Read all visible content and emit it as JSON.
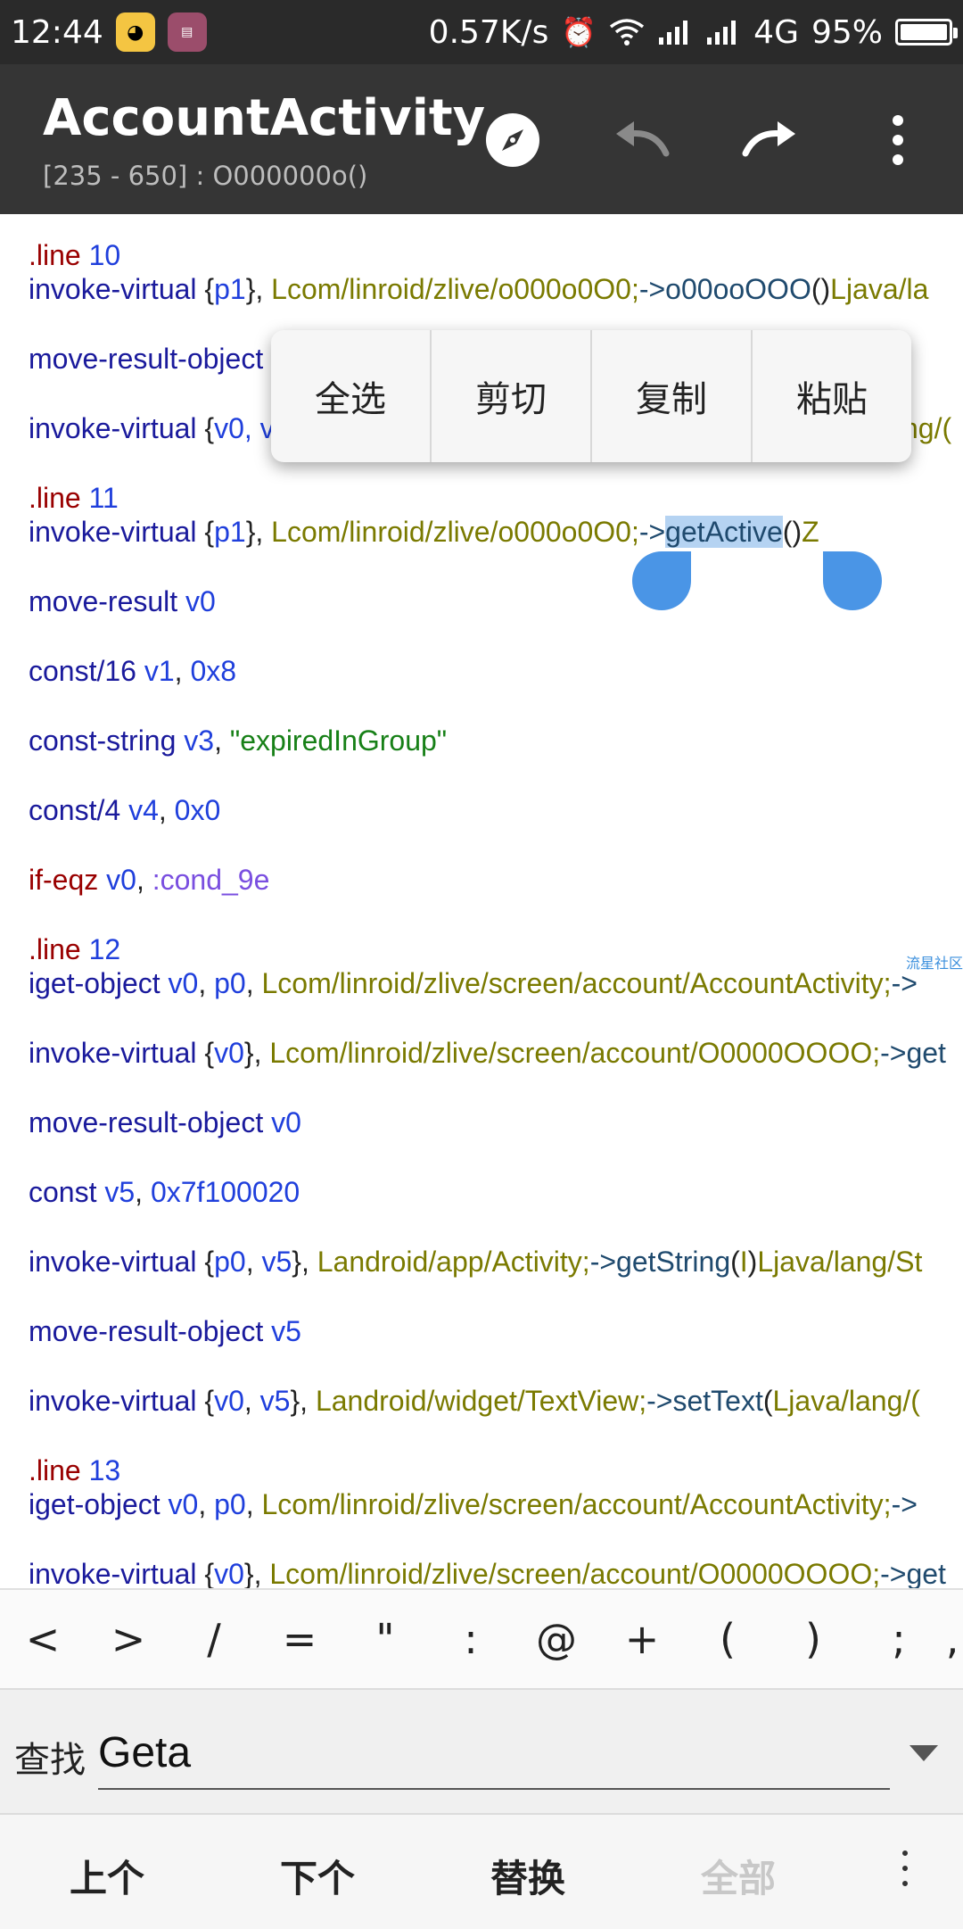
{
  "status_bar": {
    "time": "12:44",
    "app_icons": [
      "qq-icon",
      "calendar-icon"
    ],
    "net_speed": "0.57K/s",
    "network_label": "4G",
    "battery": "95%"
  },
  "app_bar": {
    "title": "AccountActivity",
    "subtitle": "[235 - 650] : O000000o()"
  },
  "context_menu": {
    "select_all": "全选",
    "cut": "剪切",
    "copy": "复制",
    "paste": "粘贴"
  },
  "code": {
    "l1_dir": ".line",
    "l1_num": "10",
    "l2_kw": "invoke-virtual",
    "l2_p1": "{",
    "l2_reg": "p1",
    "l2_p2": "},",
    "l2_cls": "Lcom/linroid/zlive/o000o0O0;",
    "l2_arrow": "->",
    "l2_mth": "o00ooOOO",
    "l2_paren": "()",
    "l2_ret": "Ljava/la",
    "l3_kw": "move-result-object",
    "l4_kw": "invoke-virtual",
    "l4_p1": "{",
    "l4_reg": "v0",
    "l4_rest": ", v",
    "l4_tail": "ng/(",
    "l5_dir": ".line",
    "l5_num": "11",
    "l6_kw": "invoke-virtual",
    "l6_p1": "{",
    "l6_reg": "p1",
    "l6_p2": "},",
    "l6_cls": "Lcom/linroid/zlive/o000o0O0;",
    "l6_arrow": "->",
    "l6_sel": "getActive",
    "l6_paren": "()",
    "l6_ret": "Z",
    "l7_kw": "move-result",
    "l7_reg": "v0",
    "l8_kw": "const/16",
    "l8_reg": "v1",
    "l8_comma": ",",
    "l8_num": "0x8",
    "l9_kw": "const-string",
    "l9_reg": "v3",
    "l9_comma": ",",
    "l9_str": "\"expiredInGroup\"",
    "l10_kw": "const/4",
    "l10_reg": "v4",
    "l10_comma": ",",
    "l10_num": "0x0",
    "l11_dir": "if-eqz",
    "l11_reg": "v0",
    "l11_comma": ",",
    "l11_lbl": ":cond_9e",
    "l12_dir": ".line",
    "l12_num": "12",
    "l13_kw": "iget-object",
    "l13_reg1": "v0",
    "l13_c1": ",",
    "l13_reg2": "p0",
    "l13_c2": ",",
    "l13_cls": "Lcom/linroid/zlive/screen/account/AccountActivity;",
    "l13_arrow": "->",
    "l14_kw": "invoke-virtual",
    "l14_p1": "{",
    "l14_reg": "v0",
    "l14_p2": "},",
    "l14_cls": "Lcom/linroid/zlive/screen/account/O0000OOOO;",
    "l14_arrow": "->",
    "l14_mth": "get",
    "l15_kw": "move-result-object",
    "l15_reg": "v0",
    "l16_kw": "const",
    "l16_reg": "v5",
    "l16_comma": ",",
    "l16_num": "0x7f100020",
    "l17_kw": "invoke-virtual",
    "l17_p1": "{",
    "l17_reg1": "p0",
    "l17_c": ",",
    "l17_reg2": "v5",
    "l17_p2": "},",
    "l17_cls": "Landroid/app/Activity;",
    "l17_arrow": "->",
    "l17_mth": "getString",
    "l17_po": "(",
    "l17_arg": "I",
    "l17_pc": ")",
    "l17_ret": "Ljava/lang/St",
    "l18_kw": "move-result-object",
    "l18_reg": "v5",
    "l19_kw": "invoke-virtual",
    "l19_p1": "{",
    "l19_reg1": "v0",
    "l19_c": ",",
    "l19_reg2": "v5",
    "l19_p2": "},",
    "l19_cls": "Landroid/widget/TextView;",
    "l19_arrow": "->",
    "l19_mth": "setText",
    "l19_po": "(",
    "l19_arg": "Ljava/lang/(",
    "l20_dir": ".line",
    "l20_num": "13",
    "l21_kw": "iget-object",
    "l21_reg1": "v0",
    "l21_c1": ",",
    "l21_reg2": "p0",
    "l21_c2": ",",
    "l21_cls": "Lcom/linroid/zlive/screen/account/AccountActivity;",
    "l21_arrow": "->",
    "l22_kw": "invoke-virtual",
    "l22_p1": "{",
    "l22_reg": "v0",
    "l22_p2": "},",
    "l22_cls": "Lcom/linroid/zlive/screen/account/O0000OOOO;",
    "l22_arrow": "->",
    "l22_mth": "get"
  },
  "watermark": "流星社区",
  "symbols": [
    "<",
    ">",
    "/",
    "=",
    "\"",
    ":",
    "@",
    "+",
    "(",
    ")",
    ";",
    ","
  ],
  "search": {
    "label": "查找",
    "value": "Geta"
  },
  "actions": {
    "prev": "上个",
    "next": "下个",
    "replace": "替换",
    "all": "全部"
  }
}
